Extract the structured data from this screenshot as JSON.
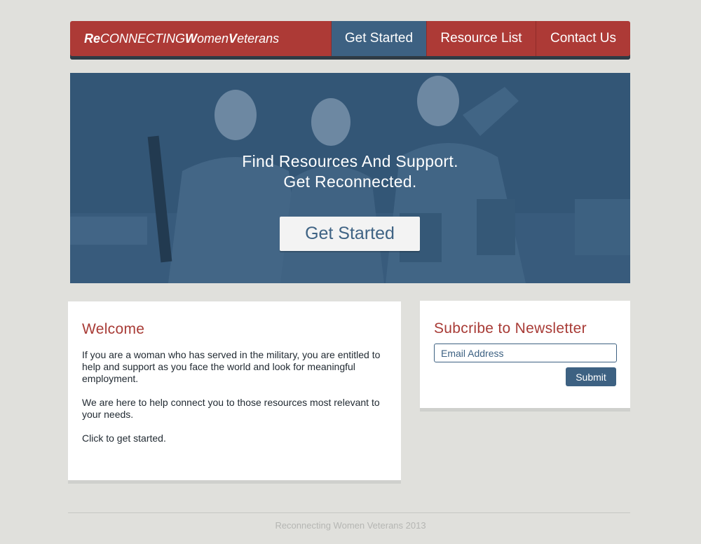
{
  "nav": {
    "brand": {
      "re": "Re",
      "connecting": "CONNECTING ",
      "w": "W",
      "omen": "omen",
      "v": "V",
      "eterans": "eterans"
    },
    "items": [
      {
        "label": "Get Started",
        "active": true
      },
      {
        "label": "Resource List",
        "active": false
      },
      {
        "label": "Contact Us",
        "active": false
      }
    ]
  },
  "hero": {
    "headline_line1": "Find Resources And Support.",
    "headline_line2": "Get Reconnected.",
    "cta_label": "Get Started"
  },
  "welcome": {
    "title": "Welcome",
    "paragraphs": [
      "If you are a woman who has served in the military, you are entitled to help and support as you face the world and look for meaningful employment.",
      "We are here to help connect you to those resources most relevant to your needs.",
      "Click to get started."
    ]
  },
  "newsletter": {
    "title": "Subcribe to Newsletter",
    "email_placeholder": "Email Address",
    "submit_label": "Submit"
  },
  "footer": {
    "text": "Reconnecting Women Veterans 2013"
  },
  "colors": {
    "brand_red": "#ad3a36",
    "brand_blue": "#3d6182",
    "background": "#e0e0dc"
  }
}
